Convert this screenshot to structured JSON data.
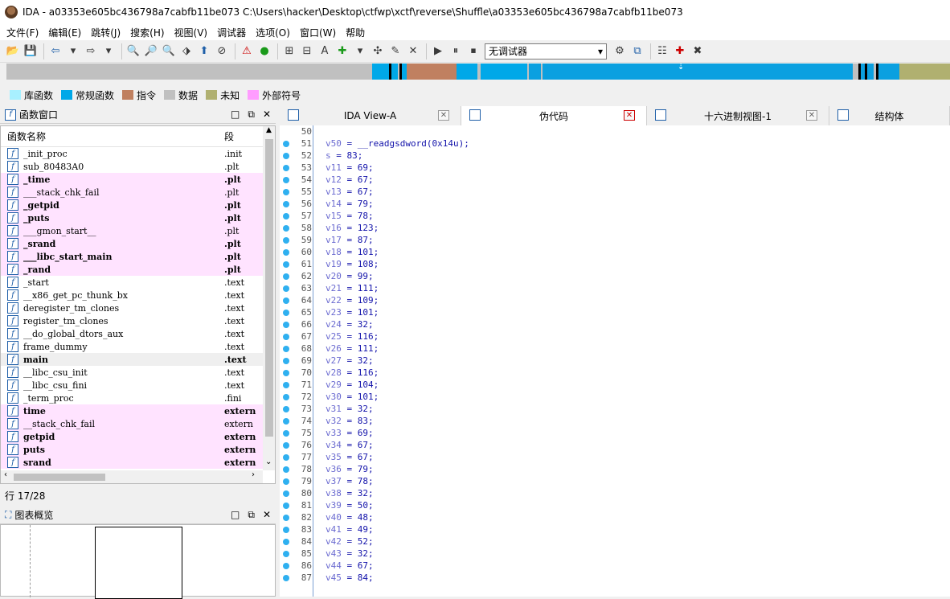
{
  "window": {
    "title": "IDA - a03353e605bc436798a7cabfb11be073 C:\\Users\\hacker\\Desktop\\ctfwp\\xctf\\reverse\\Shuffle\\a03353e605bc436798a7cabfb11be073"
  },
  "menu": [
    "文件(F)",
    "编辑(E)",
    "跳转(J)",
    "搜索(H)",
    "视图(V)",
    "调试器",
    "选项(O)",
    "窗口(W)",
    "帮助"
  ],
  "toolbar": {
    "debugger_select": "无调试器"
  },
  "legend": [
    {
      "label": "库函数",
      "color": "#a8f0ff"
    },
    {
      "label": "常规函数",
      "color": "#00a8e8"
    },
    {
      "label": "指令",
      "color": "#c08060"
    },
    {
      "label": "数据",
      "color": "#c0c0c0"
    },
    {
      "label": "未知",
      "color": "#b0b070"
    },
    {
      "label": "外部符号",
      "color": "#ff9cff"
    }
  ],
  "functions_panel": {
    "title": "函数窗口",
    "col_name": "函数名称",
    "col_segment": "段",
    "rows": [
      {
        "name": "_init_proc",
        "seg": ".init",
        "pink": false,
        "bold": false
      },
      {
        "name": "sub_80483A0",
        "seg": ".plt",
        "pink": false,
        "bold": false
      },
      {
        "name": "_time",
        "seg": ".plt",
        "pink": true,
        "bold": true
      },
      {
        "name": "___stack_chk_fail",
        "seg": ".plt",
        "pink": true,
        "bold": false
      },
      {
        "name": "_getpid",
        "seg": ".plt",
        "pink": true,
        "bold": true
      },
      {
        "name": "_puts",
        "seg": ".plt",
        "pink": true,
        "bold": true
      },
      {
        "name": "___gmon_start__",
        "seg": ".plt",
        "pink": true,
        "bold": false
      },
      {
        "name": "_srand",
        "seg": ".plt",
        "pink": true,
        "bold": true
      },
      {
        "name": "___libc_start_main",
        "seg": ".plt",
        "pink": true,
        "bold": true
      },
      {
        "name": "_rand",
        "seg": ".plt",
        "pink": true,
        "bold": true
      },
      {
        "name": "_start",
        "seg": ".text",
        "pink": false,
        "bold": false
      },
      {
        "name": "__x86_get_pc_thunk_bx",
        "seg": ".text",
        "pink": false,
        "bold": false
      },
      {
        "name": "deregister_tm_clones",
        "seg": ".text",
        "pink": false,
        "bold": false
      },
      {
        "name": "register_tm_clones",
        "seg": ".text",
        "pink": false,
        "bold": false
      },
      {
        "name": "__do_global_dtors_aux",
        "seg": ".text",
        "pink": false,
        "bold": false
      },
      {
        "name": "frame_dummy",
        "seg": ".text",
        "pink": false,
        "bold": false
      },
      {
        "name": "main",
        "seg": ".text",
        "pink": false,
        "bold": true,
        "selected": true
      },
      {
        "name": "__libc_csu_init",
        "seg": ".text",
        "pink": false,
        "bold": false
      },
      {
        "name": "__libc_csu_fini",
        "seg": ".text",
        "pink": false,
        "bold": false
      },
      {
        "name": "_term_proc",
        "seg": ".fini",
        "pink": false,
        "bold": false
      },
      {
        "name": "time",
        "seg": "extern",
        "pink": true,
        "bold": true
      },
      {
        "name": "__stack_chk_fail",
        "seg": "extern",
        "pink": true,
        "bold": false
      },
      {
        "name": "getpid",
        "seg": "extern",
        "pink": true,
        "bold": true
      },
      {
        "name": "puts",
        "seg": "extern",
        "pink": true,
        "bold": true
      },
      {
        "name": "srand",
        "seg": "extern",
        "pink": true,
        "bold": true
      }
    ],
    "status": "行 17/28"
  },
  "graph_panel": {
    "title": "图表概览"
  },
  "tabs": [
    {
      "label": "IDA View-A",
      "active": false
    },
    {
      "label": "伪代码",
      "active": true
    },
    {
      "label": "十六进制视图-1",
      "active": false
    },
    {
      "label": "结构体",
      "active": false
    }
  ],
  "code": {
    "lines": [
      {
        "ln": "50",
        "text": "",
        "dot": false
      },
      {
        "ln": "51",
        "var": "v50",
        "rhs": "__readgsdword(0x14u);",
        "dot": true,
        "func": true
      },
      {
        "ln": "52",
        "var": "s",
        "rhs": "83;",
        "dot": true
      },
      {
        "ln": "53",
        "var": "v11",
        "rhs": "69;",
        "dot": true
      },
      {
        "ln": "54",
        "var": "v12",
        "rhs": "67;",
        "dot": true
      },
      {
        "ln": "55",
        "var": "v13",
        "rhs": "67;",
        "dot": true
      },
      {
        "ln": "56",
        "var": "v14",
        "rhs": "79;",
        "dot": true
      },
      {
        "ln": "57",
        "var": "v15",
        "rhs": "78;",
        "dot": true
      },
      {
        "ln": "58",
        "var": "v16",
        "rhs": "123;",
        "dot": true
      },
      {
        "ln": "59",
        "var": "v17",
        "rhs": "87;",
        "dot": true
      },
      {
        "ln": "60",
        "var": "v18",
        "rhs": "101;",
        "dot": true
      },
      {
        "ln": "61",
        "var": "v19",
        "rhs": "108;",
        "dot": true
      },
      {
        "ln": "62",
        "var": "v20",
        "rhs": "99;",
        "dot": true
      },
      {
        "ln": "63",
        "var": "v21",
        "rhs": "111;",
        "dot": true
      },
      {
        "ln": "64",
        "var": "v22",
        "rhs": "109;",
        "dot": true
      },
      {
        "ln": "65",
        "var": "v23",
        "rhs": "101;",
        "dot": true
      },
      {
        "ln": "66",
        "var": "v24",
        "rhs": "32;",
        "dot": true
      },
      {
        "ln": "67",
        "var": "v25",
        "rhs": "116;",
        "dot": true
      },
      {
        "ln": "68",
        "var": "v26",
        "rhs": "111;",
        "dot": true
      },
      {
        "ln": "69",
        "var": "v27",
        "rhs": "32;",
        "dot": true
      },
      {
        "ln": "70",
        "var": "v28",
        "rhs": "116;",
        "dot": true
      },
      {
        "ln": "71",
        "var": "v29",
        "rhs": "104;",
        "dot": true
      },
      {
        "ln": "72",
        "var": "v30",
        "rhs": "101;",
        "dot": true
      },
      {
        "ln": "73",
        "var": "v31",
        "rhs": "32;",
        "dot": true
      },
      {
        "ln": "74",
        "var": "v32",
        "rhs": "83;",
        "dot": true
      },
      {
        "ln": "75",
        "var": "v33",
        "rhs": "69;",
        "dot": true
      },
      {
        "ln": "76",
        "var": "v34",
        "rhs": "67;",
        "dot": true
      },
      {
        "ln": "77",
        "var": "v35",
        "rhs": "67;",
        "dot": true
      },
      {
        "ln": "78",
        "var": "v36",
        "rhs": "79;",
        "dot": true
      },
      {
        "ln": "79",
        "var": "v37",
        "rhs": "78;",
        "dot": true
      },
      {
        "ln": "80",
        "var": "v38",
        "rhs": "32;",
        "dot": true
      },
      {
        "ln": "81",
        "var": "v39",
        "rhs": "50;",
        "dot": true
      },
      {
        "ln": "82",
        "var": "v40",
        "rhs": "48;",
        "dot": true
      },
      {
        "ln": "83",
        "var": "v41",
        "rhs": "49;",
        "dot": true
      },
      {
        "ln": "84",
        "var": "v42",
        "rhs": "52;",
        "dot": true
      },
      {
        "ln": "85",
        "var": "v43",
        "rhs": "32;",
        "dot": true
      },
      {
        "ln": "86",
        "var": "v44",
        "rhs": "67;",
        "dot": true
      },
      {
        "ln": "87",
        "var": "v45",
        "rhs": "84;",
        "dot": true
      }
    ]
  }
}
